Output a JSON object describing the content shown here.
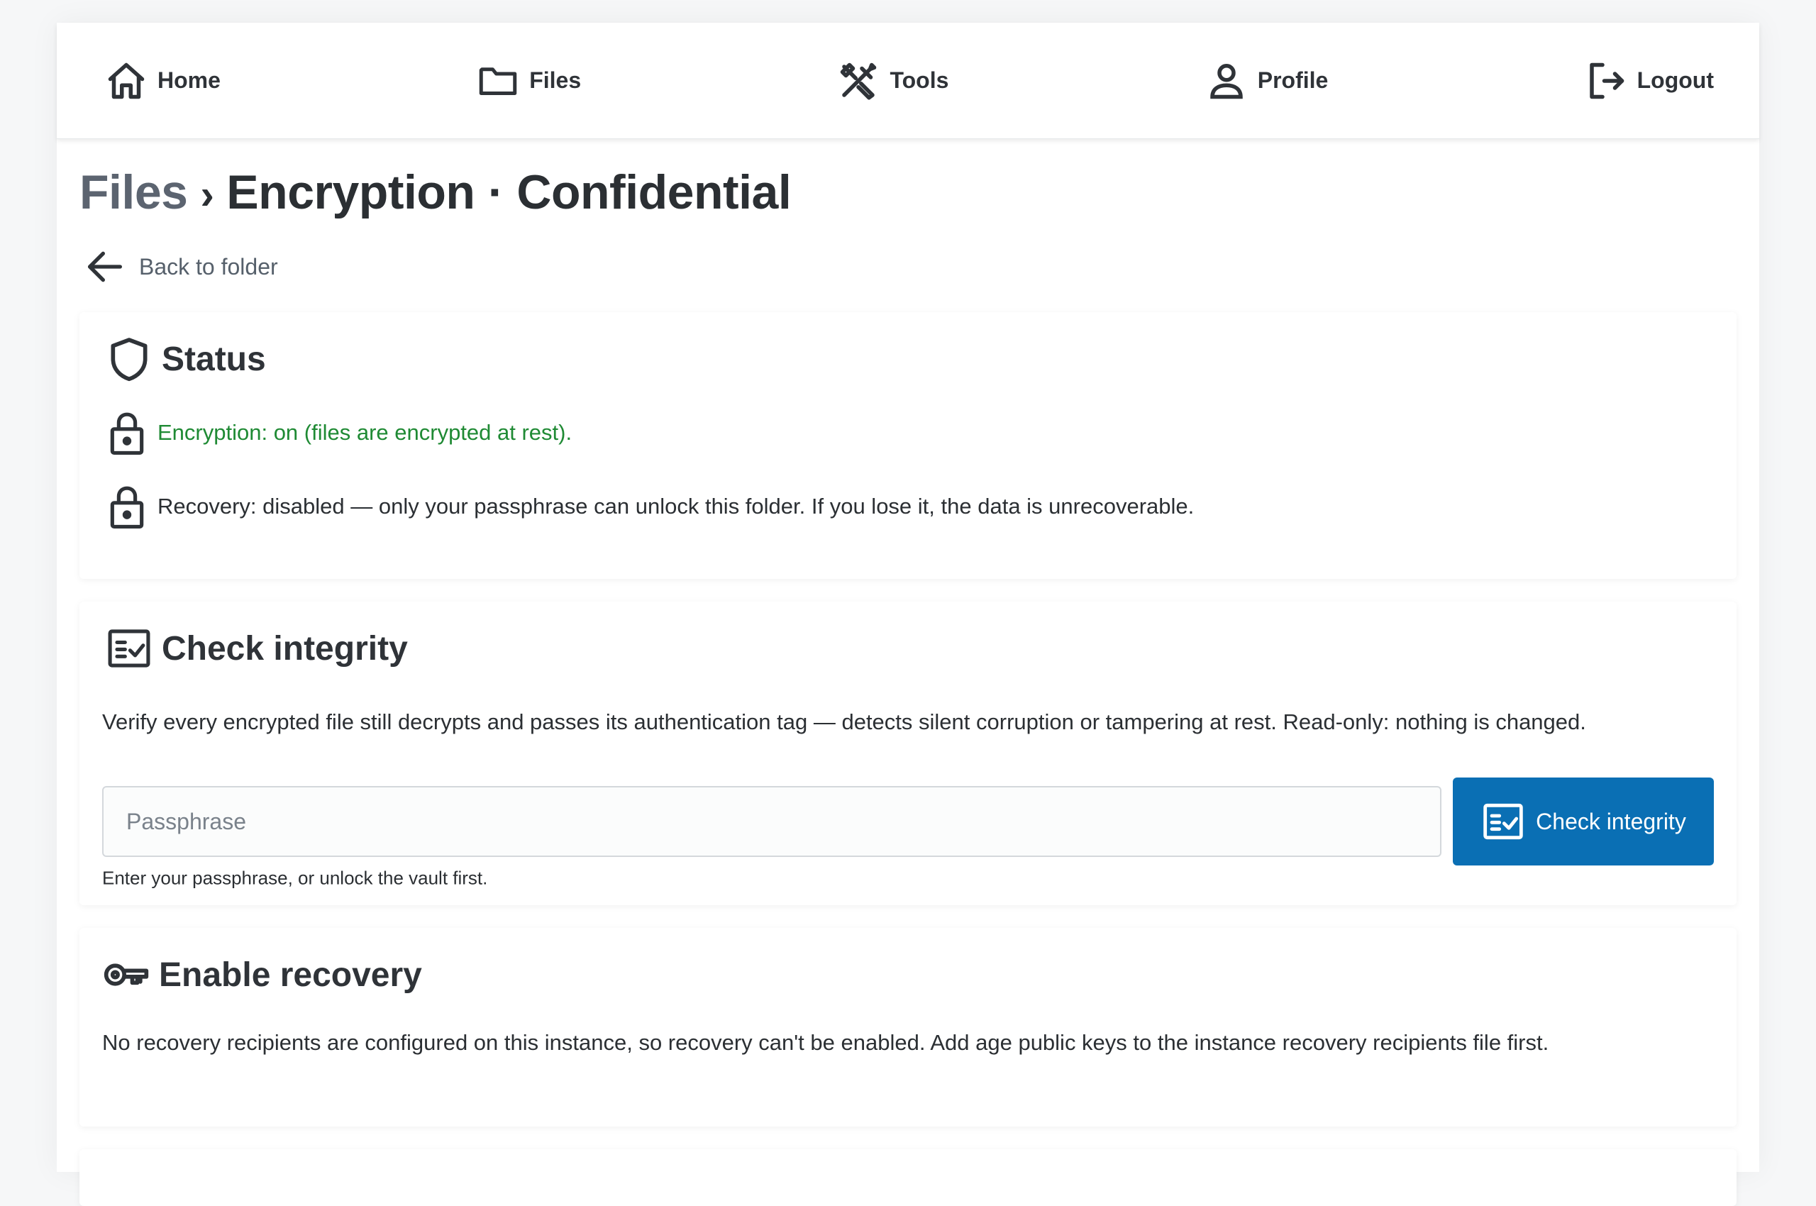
{
  "nav": {
    "home": "Home",
    "files": "Files",
    "tools": "Tools",
    "profile": "Profile",
    "logout": "Logout"
  },
  "breadcrumb": {
    "parent": "Files",
    "separator": "›",
    "current": "Encryption · Confidential"
  },
  "back_link": "Back to folder",
  "status": {
    "title": "Status",
    "encryption": "Encryption: on (files are encrypted at rest).",
    "recovery": "Recovery: disabled — only your passphrase can unlock this folder. If you lose it, the data is unrecoverable."
  },
  "integrity": {
    "title": "Check integrity",
    "description": "Verify every encrypted file still decrypts and passes its authentication tag — detects silent corruption or tampering at rest. Read-only: nothing is changed.",
    "placeholder": "Passphrase",
    "button": "Check integrity",
    "hint": "Enter your passphrase, or unlock the vault first."
  },
  "recovery": {
    "title": "Enable recovery",
    "description": "No recovery recipients are configured on this instance, so recovery can't be enabled. Add age public keys to the instance recovery recipients file first."
  },
  "colors": {
    "accent": "#0a6fb4",
    "ok": "#1f8a34",
    "text": "#2b2f33",
    "muted": "#5c6470"
  }
}
